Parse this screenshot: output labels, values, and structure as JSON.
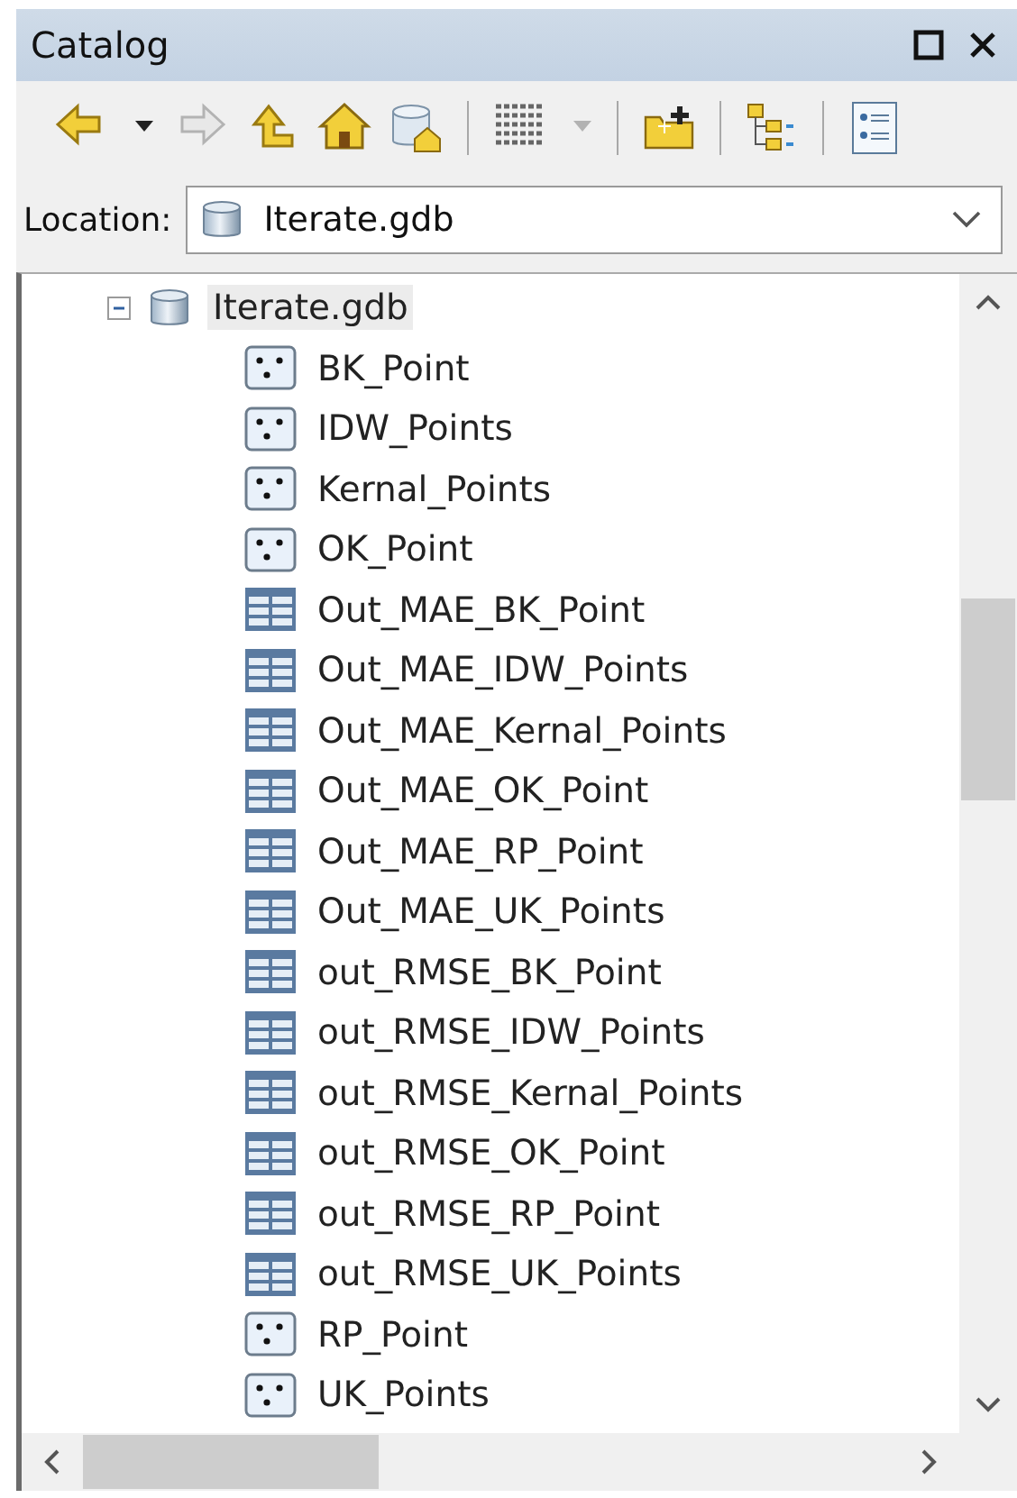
{
  "window": {
    "title": "Catalog",
    "buttons": [
      {
        "kind": "maximize"
      },
      {
        "kind": "close"
      }
    ]
  },
  "toolbar": [
    {
      "kind": "back",
      "disabled": false
    },
    {
      "kind": "caret",
      "disabled": false
    },
    {
      "kind": "forward",
      "disabled": true
    },
    {
      "kind": "up",
      "disabled": false
    },
    {
      "kind": "home",
      "disabled": false
    },
    {
      "kind": "dbhome",
      "disabled": false
    },
    {
      "kind": "sep"
    },
    {
      "kind": "listview",
      "disabled": false
    },
    {
      "kind": "caret",
      "disabled": true
    },
    {
      "kind": "sep"
    },
    {
      "kind": "connect",
      "disabled": false
    },
    {
      "kind": "sep"
    },
    {
      "kind": "tree",
      "disabled": false
    },
    {
      "kind": "sep"
    },
    {
      "kind": "details",
      "disabled": false
    }
  ],
  "location": {
    "label": "Location:",
    "value": "Iterate.gdb"
  },
  "tree": {
    "root": {
      "label": "Iterate.gdb",
      "kind": "gdb",
      "expanded": true,
      "selected": true,
      "children": [
        {
          "label": "BK_Point",
          "kind": "point",
          "selected": false
        },
        {
          "label": "IDW_Points",
          "kind": "point",
          "selected": false
        },
        {
          "label": "Kernal_Points",
          "kind": "point",
          "selected": false
        },
        {
          "label": "OK_Point",
          "kind": "point",
          "selected": false
        },
        {
          "label": "Out_MAE_BK_Point",
          "kind": "table",
          "selected": false
        },
        {
          "label": "Out_MAE_IDW_Points",
          "kind": "table",
          "selected": false
        },
        {
          "label": "Out_MAE_Kernal_Points",
          "kind": "table",
          "selected": false
        },
        {
          "label": "Out_MAE_OK_Point",
          "kind": "table",
          "selected": false
        },
        {
          "label": "Out_MAE_RP_Point",
          "kind": "table",
          "selected": false
        },
        {
          "label": "Out_MAE_UK_Points",
          "kind": "table",
          "selected": false
        },
        {
          "label": "out_RMSE_BK_Point",
          "kind": "table",
          "selected": false
        },
        {
          "label": "out_RMSE_IDW_Points",
          "kind": "table",
          "selected": false
        },
        {
          "label": "out_RMSE_Kernal_Points",
          "kind": "table",
          "selected": false
        },
        {
          "label": "out_RMSE_OK_Point",
          "kind": "table",
          "selected": false
        },
        {
          "label": "out_RMSE_RP_Point",
          "kind": "table",
          "selected": false
        },
        {
          "label": "out_RMSE_UK_Points",
          "kind": "table",
          "selected": false
        },
        {
          "label": "RP_Point",
          "kind": "point",
          "selected": false
        },
        {
          "label": "UK_Points",
          "kind": "point",
          "selected": false
        }
      ]
    }
  }
}
